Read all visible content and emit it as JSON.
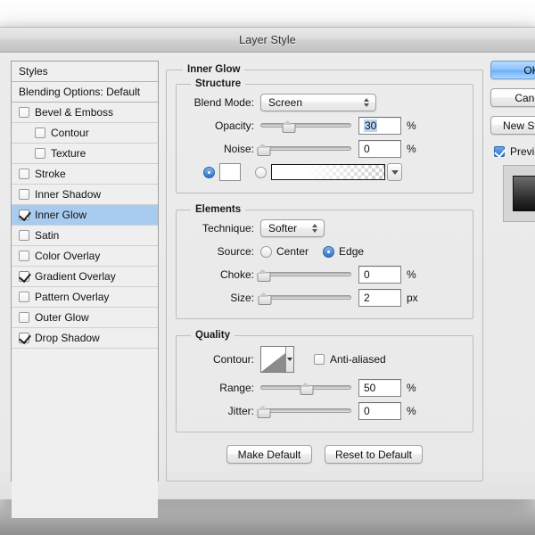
{
  "window": {
    "title": "Layer Style"
  },
  "styles_panel": {
    "header_label": "Styles",
    "blending_options_label": "Blending Options: Default",
    "items": [
      {
        "label": "Bevel & Emboss",
        "checked": false,
        "indent": false,
        "selected": false
      },
      {
        "label": "Contour",
        "checked": false,
        "indent": true,
        "selected": false
      },
      {
        "label": "Texture",
        "checked": false,
        "indent": true,
        "selected": false
      },
      {
        "label": "Stroke",
        "checked": false,
        "indent": false,
        "selected": false
      },
      {
        "label": "Inner Shadow",
        "checked": false,
        "indent": false,
        "selected": false
      },
      {
        "label": "Inner Glow",
        "checked": true,
        "indent": false,
        "selected": true
      },
      {
        "label": "Satin",
        "checked": false,
        "indent": false,
        "selected": false
      },
      {
        "label": "Color Overlay",
        "checked": false,
        "indent": false,
        "selected": false
      },
      {
        "label": "Gradient Overlay",
        "checked": true,
        "indent": false,
        "selected": false
      },
      {
        "label": "Pattern Overlay",
        "checked": false,
        "indent": false,
        "selected": false
      },
      {
        "label": "Outer Glow",
        "checked": false,
        "indent": false,
        "selected": false
      },
      {
        "label": "Drop Shadow",
        "checked": true,
        "indent": false,
        "selected": false
      }
    ]
  },
  "options": {
    "effect_group_label": "Inner Glow",
    "structure": {
      "group_label": "Structure",
      "blend_mode_label": "Blend Mode:",
      "blend_mode_value": "Screen",
      "opacity_label": "Opacity:",
      "opacity_value": "30",
      "opacity_unit": "%",
      "opacity_percent": 30,
      "noise_label": "Noise:",
      "noise_value": "0",
      "noise_unit": "%",
      "noise_percent": 0,
      "fill_color_selected": true,
      "fill_gradient_selected": false,
      "color_swatch_hex": "#ffffff"
    },
    "elements": {
      "group_label": "Elements",
      "technique_label": "Technique:",
      "technique_value": "Softer",
      "source_label": "Source:",
      "source_center_label": "Center",
      "source_edge_label": "Edge",
      "source_value": "Edge",
      "choke_label": "Choke:",
      "choke_value": "0",
      "choke_unit": "%",
      "choke_percent": 0,
      "size_label": "Size:",
      "size_value": "2",
      "size_unit": "px",
      "size_percent": 1
    },
    "quality": {
      "group_label": "Quality",
      "contour_label": "Contour:",
      "anti_aliased_label": "Anti-aliased",
      "anti_aliased_checked": false,
      "range_label": "Range:",
      "range_value": "50",
      "range_unit": "%",
      "range_percent": 50,
      "jitter_label": "Jitter:",
      "jitter_value": "0",
      "jitter_unit": "%",
      "jitter_percent": 0
    },
    "make_default_label": "Make Default",
    "reset_to_default_label": "Reset to Default"
  },
  "right_buttons": {
    "ok_label": "OK",
    "cancel_label": "Cancel",
    "new_style_label": "New Style...",
    "preview_label": "Preview",
    "preview_checked": true
  },
  "colors": {
    "accent_selection": "#a8cbf0",
    "default_button": "#8cc2fb",
    "text_selection": "#b8d4f2",
    "dialog_bg": "#ececec",
    "panel_bg": "#efefef"
  }
}
